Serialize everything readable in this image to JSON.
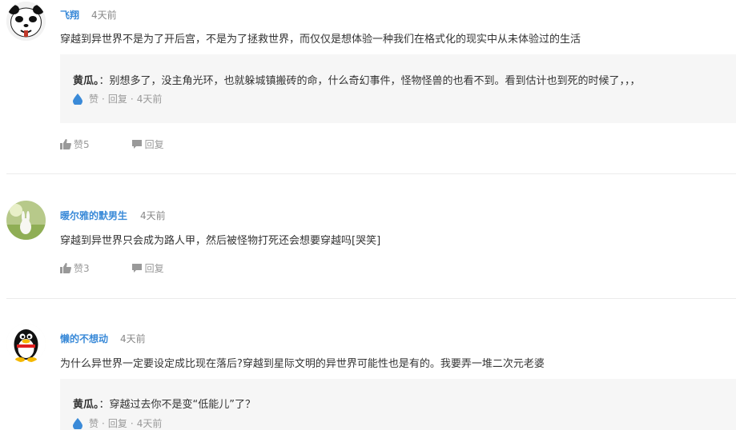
{
  "comments": [
    {
      "username": "飞翔",
      "time": "4天前",
      "text": "穿越到异世界不是为了开后宫，不是为了拯救世界，而仅仅是想体验一种我们在格式化的现实中从未体验过的生活",
      "reply": {
        "author": "黄瓜。",
        "text": "：别想多了，没主角光环，也就躲城镇搬砖的命，什么奇幻事件，怪物怪兽的也看不到。看到估计也到死的时候了，，，",
        "like_label": "赞",
        "reply_label": "回复",
        "time": "4天前"
      },
      "like_label": "赞5",
      "reply_label": "回复"
    },
    {
      "username": "暖尔雅的默男生",
      "time": "4天前",
      "text": "穿越到异世界只会成为路人甲，然后被怪物打死还会想要穿越吗[哭笑]",
      "like_label": "赞3",
      "reply_label": "回复"
    },
    {
      "username": "懒的不想动",
      "time": "4天前",
      "text": "为什么异世界一定要设定成比现在落后?穿越到星际文明的异世界可能性也是有的。我要弄一堆二次元老婆",
      "reply": {
        "author": "黄瓜。",
        "text": "：穿越过去你不是变“低能儿”了？",
        "like_label": "赞",
        "reply_label": "回复",
        "time": "4天前"
      }
    }
  ],
  "separator": "·",
  "colors": {
    "username": "#3a8ad8",
    "meta": "#999999",
    "reply_bg": "#f6f6f6",
    "drop_icon": "#3a8ad8"
  }
}
